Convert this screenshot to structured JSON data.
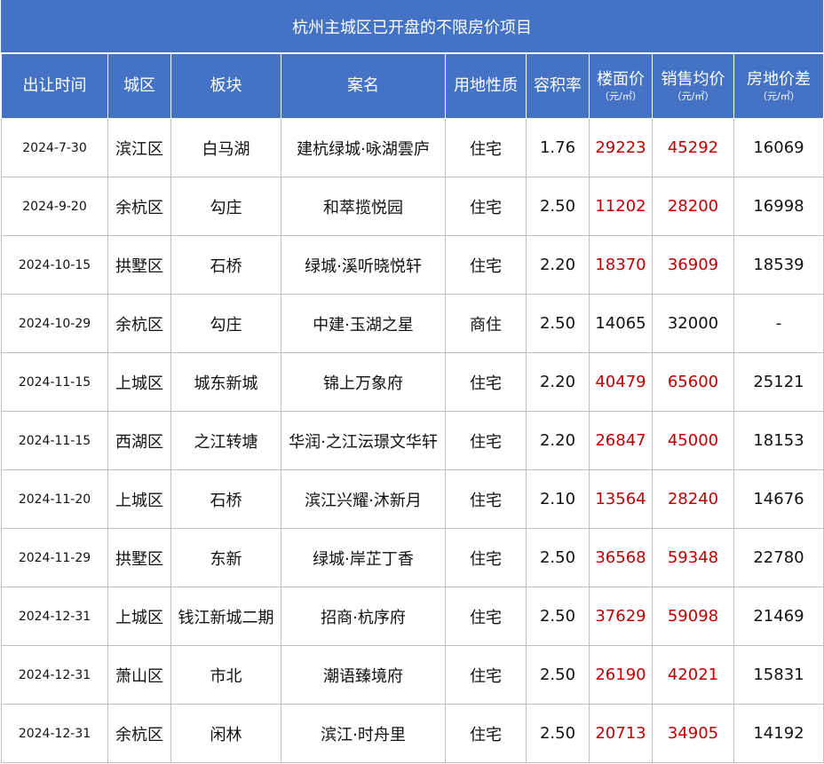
{
  "title": "杭州主城区已开盘的不限房价项目",
  "headers": [
    {
      "label": "出让时间",
      "unit": ""
    },
    {
      "label": "城区",
      "unit": ""
    },
    {
      "label": "板块",
      "unit": ""
    },
    {
      "label": "案名",
      "unit": ""
    },
    {
      "label": "用地性质",
      "unit": ""
    },
    {
      "label": "容积率",
      "unit": ""
    },
    {
      "label": "楼面价",
      "unit": "（元/㎡）"
    },
    {
      "label": "销售均价",
      "unit": "（元/㎡）"
    },
    {
      "label": "房地价差",
      "unit": "（元/㎡）"
    }
  ],
  "colors": {
    "header_bg": "#4472c4",
    "highlight_red": "#c00000",
    "grid": "#bfbfbf"
  },
  "rows": [
    {
      "date": "2024-7-30",
      "district": "滨江区",
      "area": "白马湖",
      "name": "建杭绿城·咏湖雲庐",
      "use": "住宅",
      "far": "1.76",
      "land_price": "29223",
      "sale_price": "45292",
      "diff": "16069",
      "red": true
    },
    {
      "date": "2024-9-20",
      "district": "余杭区",
      "area": "勾庄",
      "name": "和萃揽悦园",
      "use": "住宅",
      "far": "2.50",
      "land_price": "11202",
      "sale_price": "28200",
      "diff": "16998",
      "red": true
    },
    {
      "date": "2024-10-15",
      "district": "拱墅区",
      "area": "石桥",
      "name": "绿城·溪听晓悦轩",
      "use": "住宅",
      "far": "2.20",
      "land_price": "18370",
      "sale_price": "36909",
      "diff": "18539",
      "red": true
    },
    {
      "date": "2024-10-29",
      "district": "余杭区",
      "area": "勾庄",
      "name": "中建·玉湖之星",
      "use": "商住",
      "far": "2.50",
      "land_price": "14065",
      "sale_price": "32000",
      "diff": "-",
      "red": false
    },
    {
      "date": "2024-11-15",
      "district": "上城区",
      "area": "城东新城",
      "name": "锦上万象府",
      "use": "住宅",
      "far": "2.20",
      "land_price": "40479",
      "sale_price": "65600",
      "diff": "25121",
      "red": true
    },
    {
      "date": "2024-11-15",
      "district": "西湖区",
      "area": "之江转塘",
      "name": "华润·之江沄璟文华轩",
      "use": "住宅",
      "far": "2.20",
      "land_price": "26847",
      "sale_price": "45000",
      "diff": "18153",
      "red": true
    },
    {
      "date": "2024-11-20",
      "district": "上城区",
      "area": "石桥",
      "name": "滨江兴耀·沐新月",
      "use": "住宅",
      "far": "2.10",
      "land_price": "13564",
      "sale_price": "28240",
      "diff": "14676",
      "red": true
    },
    {
      "date": "2024-11-29",
      "district": "拱墅区",
      "area": "东新",
      "name": "绿城·岸芷丁香",
      "use": "住宅",
      "far": "2.50",
      "land_price": "36568",
      "sale_price": "59348",
      "diff": "22780",
      "red": true
    },
    {
      "date": "2024-12-31",
      "district": "上城区",
      "area": "钱江新城二期",
      "name": "招商·杭序府",
      "use": "住宅",
      "far": "2.50",
      "land_price": "37629",
      "sale_price": "59098",
      "diff": "21469",
      "red": true
    },
    {
      "date": "2024-12-31",
      "district": "萧山区",
      "area": "市北",
      "name": "潮语臻境府",
      "use": "住宅",
      "far": "2.50",
      "land_price": "26190",
      "sale_price": "42021",
      "diff": "15831",
      "red": true
    },
    {
      "date": "2024-12-31",
      "district": "余杭区",
      "area": "闲林",
      "name": "滨江·时舟里",
      "use": "住宅",
      "far": "2.50",
      "land_price": "20713",
      "sale_price": "34905",
      "diff": "14192",
      "red": true
    }
  ]
}
